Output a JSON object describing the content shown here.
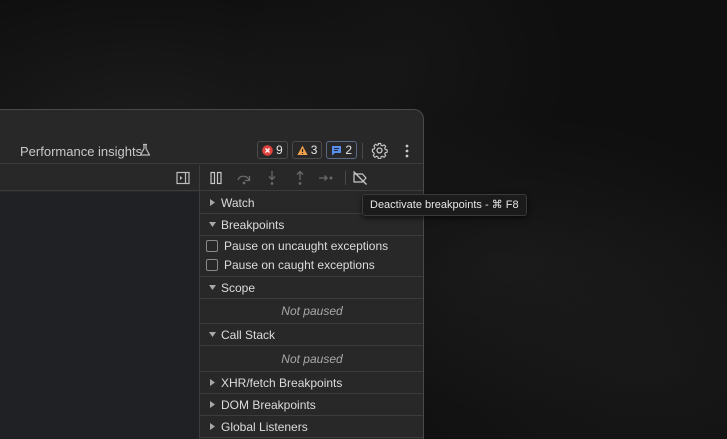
{
  "tabbar": {
    "tab_label": "Performance insights",
    "tab_icon": "flask-icon",
    "errors_count": "9",
    "warnings_count": "3",
    "messages_count": "2"
  },
  "debugger": {
    "tooltip": "Deactivate breakpoints - ⌘ F8",
    "sections": {
      "watch": "Watch",
      "breakpoints": "Breakpoints",
      "scope": "Scope",
      "call_stack": "Call Stack",
      "xhr": "XHR/fetch Breakpoints",
      "dom": "DOM Breakpoints",
      "global": "Global Listeners"
    },
    "pause_uncaught": "Pause on uncaught exceptions",
    "pause_caught": "Pause on caught exceptions",
    "scope_status": "Not paused",
    "callstack_status": "Not paused"
  },
  "colors": {
    "error": "#e0443e",
    "warning": "#f0a24a",
    "message": "#5b8ee8"
  }
}
